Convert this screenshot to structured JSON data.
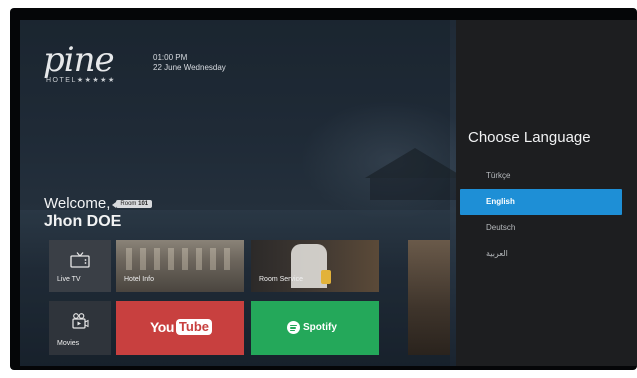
{
  "header": {
    "logo_word": "pine",
    "logo_sub": "HOTEL★★★★★",
    "time": "01:00 PM",
    "date": "22 June Wednesday"
  },
  "welcome": {
    "greeting": "Welcome,",
    "room_label": "Room",
    "room_number": "101",
    "guest_name": "Jhon DOE"
  },
  "tiles": {
    "live_tv": {
      "label": "Live TV",
      "icon": "tv-icon"
    },
    "movies": {
      "label": "Movies",
      "icon": "movie-icon"
    },
    "hotel_info": {
      "label": "Hotel Info"
    },
    "room_service": {
      "label": "Room Service"
    },
    "youtube": {
      "you": "You",
      "tube": "Tube",
      "color": "#c8403f"
    },
    "spotify": {
      "label": "Spotify",
      "color": "#24a85a"
    }
  },
  "language_panel": {
    "title": "Choose Language",
    "options": [
      "Türkçe",
      "English",
      "Deutsch",
      "العربية"
    ],
    "selected": "English",
    "accent": "#1e8fd6"
  }
}
